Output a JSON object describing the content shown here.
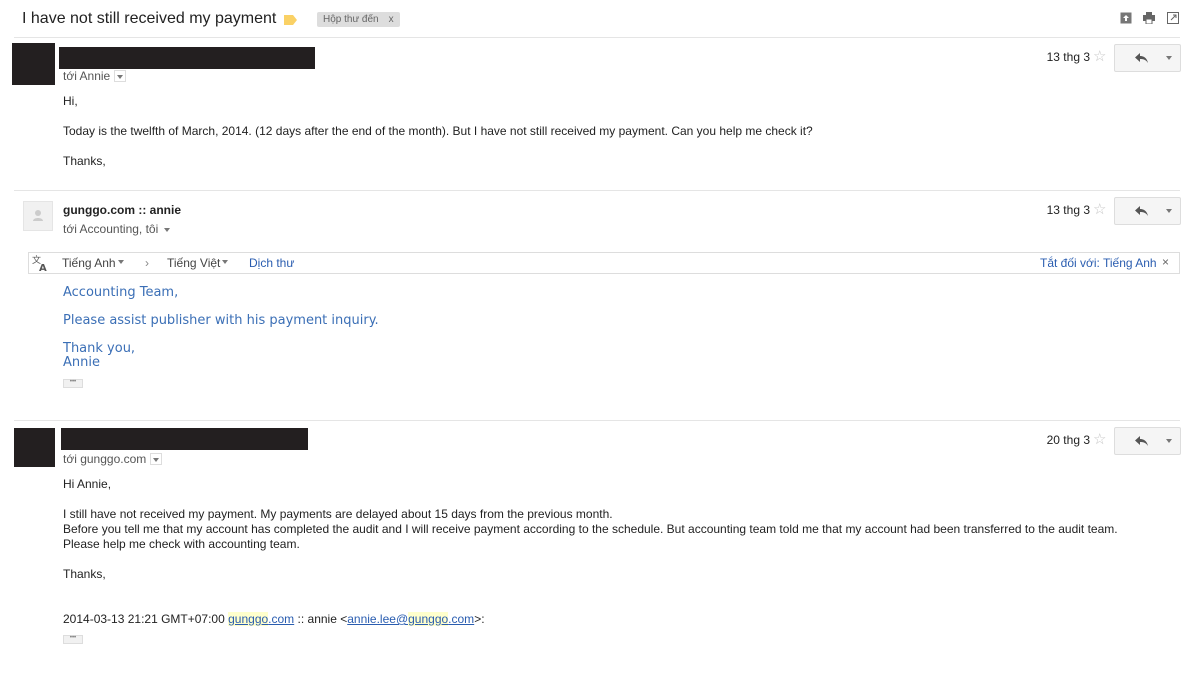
{
  "header": {
    "subject": "I have not still received my payment",
    "inbox_label": "Hộp thư đến",
    "inbox_label_remove": "x"
  },
  "messages": [
    {
      "to": "tới Annie",
      "date": "13 thg 3",
      "lines": [
        "Hi,",
        "Today is the twelfth of March, 2014. (12 days after the end of the month). But I have not still received my payment. Can you help me check it?",
        "Thanks,"
      ]
    },
    {
      "sender": "gunggo.com :: annie",
      "to": "tới Accounting, tôi",
      "date": "13 thg 3",
      "translate": {
        "source_lang": "Tiếng Anh",
        "arrow": "›",
        "target_lang": "Tiếng Việt",
        "translate_link": "Dịch thư",
        "turn_off": "Tắt đối với: Tiếng Anh",
        "close": "×"
      },
      "lines": [
        "Accounting Team,",
        "Please assist publisher with his payment inquiry.",
        "Thank you,",
        "Annie"
      ]
    },
    {
      "to": "tới gunggo.com",
      "date": "20 thg 3",
      "lines": [
        "Hi Annie,",
        "I still have not received my payment. My payments are delayed about 15 days from the previous month.",
        "Before you tell me that my account has completed the audit and I will receive payment according to the schedule. But accounting team told me that my account had been transferred to the audit team.",
        "Please help me check with accounting team.",
        "Thanks,"
      ],
      "quote": {
        "prefix": "2014-03-13 21:21 GMT+07:00 ",
        "link1_a": "gunggo",
        "link1_b": ".com",
        "middle": " :: annie <",
        "link2_a": "annie.lee@",
        "link2_b": "gunggo",
        "link2_c": ".com",
        "suffix": ">:"
      }
    }
  ],
  "icons": {
    "star": "☆",
    "reply": "⮌",
    "ellipsis": "•••",
    "colors": {
      "accent_blue": "#3b6fb6",
      "redaction": "#231f20",
      "label_yellow": "#fad165"
    }
  }
}
